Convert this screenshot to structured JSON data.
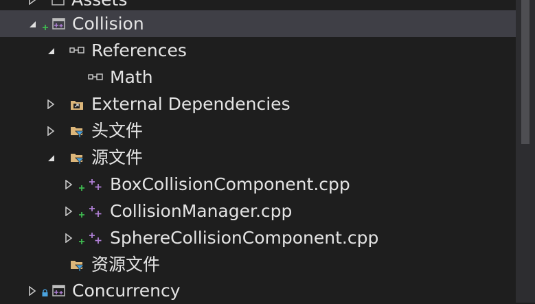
{
  "tree": {
    "rows": [
      {
        "label": "Assets",
        "icon": "project-icon"
      },
      {
        "label": "Collision",
        "icon": "project-icon"
      },
      {
        "label": "References",
        "icon": "references-icon"
      },
      {
        "label": "Math",
        "icon": "reference-icon"
      },
      {
        "label": "External Dependencies",
        "icon": "external-dependencies-icon"
      },
      {
        "label": "头文件",
        "icon": "filter-folder-icon"
      },
      {
        "label": "源文件",
        "icon": "filter-folder-icon"
      },
      {
        "label": "BoxCollisionComponent.cpp",
        "icon": "cpp-file-icon"
      },
      {
        "label": "CollisionManager.cpp",
        "icon": "cpp-file-icon"
      },
      {
        "label": "SphereCollisionComponent.cpp",
        "icon": "cpp-file-icon"
      },
      {
        "label": "资源文件",
        "icon": "filter-folder-icon"
      },
      {
        "label": "Concurrency",
        "icon": "project-icon"
      }
    ],
    "selected_index": 1
  },
  "colors": {
    "background": "#1e1e1e",
    "selection": "#3f3f46",
    "text": "#e4e4e4",
    "added_green": "#3fb950",
    "cpp_purple": "#b180d7",
    "folder": "#dcb67a",
    "filter_blue": "#4aa3df"
  }
}
